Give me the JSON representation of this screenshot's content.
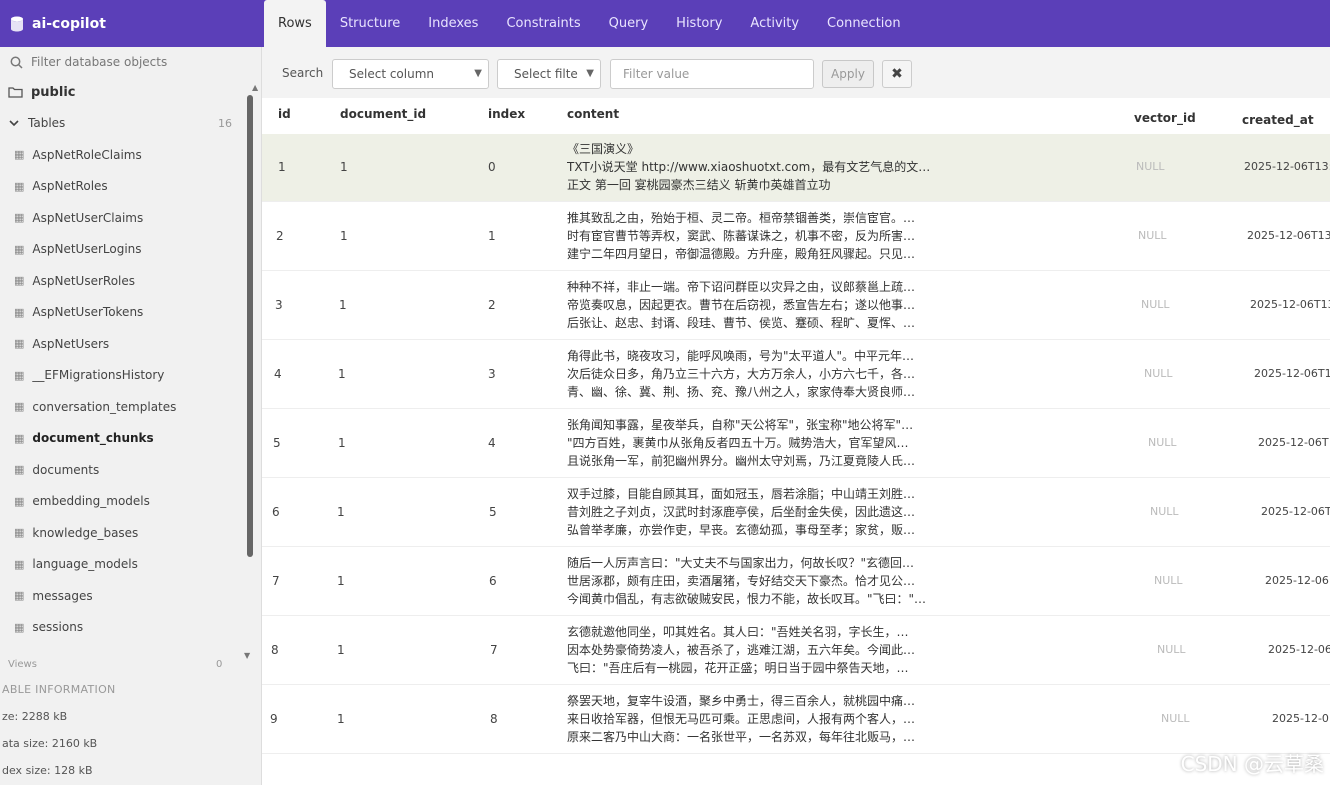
{
  "app": {
    "title": "ai-copilot"
  },
  "tabs": [
    {
      "label": "Rows",
      "active": true
    },
    {
      "label": "Structure"
    },
    {
      "label": "Indexes"
    },
    {
      "label": "Constraints"
    },
    {
      "label": "Query"
    },
    {
      "label": "History"
    },
    {
      "label": "Activity"
    },
    {
      "label": "Connection"
    }
  ],
  "sidebar": {
    "filter_placeholder": "Filter database objects",
    "schema": "public",
    "tables_label": "Tables",
    "tables_count": "16",
    "items": [
      {
        "label": "AspNetRoleClaims"
      },
      {
        "label": "AspNetRoles"
      },
      {
        "label": "AspNetUserClaims"
      },
      {
        "label": "AspNetUserLogins"
      },
      {
        "label": "AspNetUserRoles"
      },
      {
        "label": "AspNetUserTokens"
      },
      {
        "label": "AspNetUsers"
      },
      {
        "label": "__EFMigrationsHistory"
      },
      {
        "label": "conversation_templates"
      },
      {
        "label": "document_chunks",
        "selected": true
      },
      {
        "label": "documents"
      },
      {
        "label": "embedding_models"
      },
      {
        "label": "knowledge_bases"
      },
      {
        "label": "language_models"
      },
      {
        "label": "messages"
      },
      {
        "label": "sessions"
      }
    ],
    "views_label": "Views",
    "views_count": "0",
    "info": {
      "heading": "ABLE INFORMATION",
      "size": "ze: 2288 kB",
      "data_size": "ata size: 2160 kB",
      "index_size": "dex size: 128 kB"
    }
  },
  "filter": {
    "search_label": "Search",
    "column_select": "Select column",
    "filter_select": "Select filte",
    "value_placeholder": "Filter value",
    "apply_label": "Apply",
    "clear_label": "✖"
  },
  "table": {
    "columns": [
      "id",
      "document_id",
      "index",
      "content",
      "vector_id",
      "created_at"
    ],
    "rows": [
      {
        "id": "1",
        "document_id": "1",
        "index": "0",
        "content": [
          "《三国演义》",
          "TXT小说天堂  http://www.xiaoshuotxt.com，最有文艺气息的文…",
          "正文 第一回   宴桃园豪杰三结义   斩黄巾英雄首立功"
        ],
        "vector_id": "NULL",
        "created_at": "2025-12-06T13:0"
      },
      {
        "id": "2",
        "document_id": "1",
        "index": "1",
        "content": [
          "推其致乱之由，殆始于桓、灵二帝。桓帝禁锢善类，崇信宦官。…",
          "时有宦官曹节等弄权，窦武、陈蕃谋诛之，机事不密，反为所害…",
          "建宁二年四月望日，帝御温德殿。方升座，殿角狂风骤起。只见…"
        ],
        "vector_id": "NULL",
        "created_at": "2025-12-06T13"
      },
      {
        "id": "3",
        "document_id": "1",
        "index": "2",
        "content": [
          "种种不祥，非止一端。帝下诏问群臣以灾异之由，议郎蔡邕上疏…",
          "帝览奏叹息，因起更衣。曹节在后窃视，悉宣告左右；遂以他事…",
          "后张让、赵忠、封谞、段珪、曹节、侯览、蹇硕、程旷、夏恽、…"
        ],
        "vector_id": "NULL",
        "created_at": "2025-12-06T13"
      },
      {
        "id": "4",
        "document_id": "1",
        "index": "3",
        "content": [
          "角得此书，晓夜攻习，能呼风唤雨，号为\"太平道人\"。中平元年…",
          "次后徒众日多，角乃立三十六方，大方万余人，小方六七千，各…",
          "青、幽、徐、冀、荆、扬、兖、豫八州之人，家家侍奉大贤良师…"
        ],
        "vector_id": "NULL",
        "created_at": "2025-12-06T1"
      },
      {
        "id": "5",
        "document_id": "1",
        "index": "4",
        "content": [
          "张角闻知事露，星夜举兵，自称\"天公将军\"，张宝称\"地公将军\"…",
          "\"四方百姓，裹黄巾从张角反者四五十万。贼势浩大，官军望风…",
          "且说张角一军，前犯幽州界分。幽州太守刘焉，乃江夏竟陵人氏…"
        ],
        "vector_id": "NULL",
        "created_at": "2025-12-06T"
      },
      {
        "id": "6",
        "document_id": "1",
        "index": "5",
        "content": [
          "双手过膝，目能自顾其耳，面如冠玉，唇若涂脂；中山靖王刘胜…",
          "昔刘胜之子刘贞，汉武时封涿鹿亭侯，后坐酎金失侯，因此遗这…",
          "弘曾举孝廉，亦尝作吏，早丧。玄德幼孤，事母至孝；家贫，贩…"
        ],
        "vector_id": "NULL",
        "created_at": "2025-12-06T"
      },
      {
        "id": "7",
        "document_id": "1",
        "index": "6",
        "content": [
          "随后一人厉声言曰：\"大丈夫不与国家出力，何故长叹？\"玄德回…",
          "世居涿郡，颇有庄田，卖酒屠猪，专好结交天下豪杰。恰才见公…",
          "今闻黄巾倡乱，有志欲破贼安民，恨力不能，故长叹耳。\"飞曰：\"…"
        ],
        "vector_id": "NULL",
        "created_at": "2025-12-06"
      },
      {
        "id": "8",
        "document_id": "1",
        "index": "7",
        "content": [
          "玄德就邀他同坐，叩其姓名。其人曰：\"吾姓关名羽，字长生，…",
          "因本处势豪倚势凌人，被吾杀了，逃难江湖，五六年矣。今闻此…",
          "飞曰：\"吾庄后有一桃园，花开正盛；明日当于园中祭告天地，…"
        ],
        "vector_id": "NULL",
        "created_at": "2025-12-06"
      },
      {
        "id": "9",
        "document_id": "1",
        "index": "8",
        "content": [
          "祭罢天地，复宰牛设酒，聚乡中勇士，得三百余人，就桃园中痛…",
          "来日收拾军器，但恨无马匹可乘。正思虑间，人报有两个客人，…",
          "原来二客乃中山大商：一名张世平，一名苏双，每年往北贩马，…"
        ],
        "vector_id": "NULL",
        "created_at": "2025-12-0"
      }
    ]
  },
  "watermark": "CSDN @云草桑"
}
